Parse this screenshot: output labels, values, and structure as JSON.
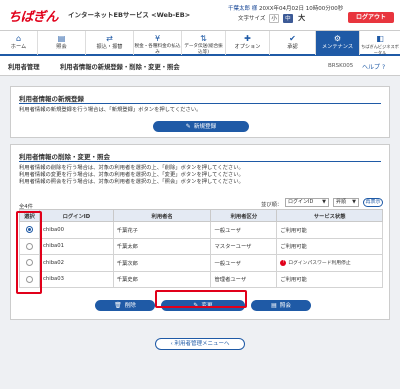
{
  "header": {
    "logo_text": "ちばぎん",
    "service_name": "インターネットEBサービス <Web-EB>",
    "user_name": "千葉太郎 様",
    "last_login": "20XX年04月02日 10時00分00秒",
    "font_size_label": "文字サイズ",
    "font_sizes": [
      "小",
      "中",
      "大"
    ],
    "logout_label": "ログアウト"
  },
  "nav": {
    "items": [
      {
        "label": "ホーム",
        "icon": "home-icon"
      },
      {
        "label": "照会",
        "icon": "inquiry-icon"
      },
      {
        "label": "振込・振替",
        "icon": "transfer-icon"
      },
      {
        "label": "税金・各種料金の払込み",
        "icon": "tax-icon"
      },
      {
        "label": "データ伝送(総合振込等)",
        "icon": "data-transfer-icon"
      },
      {
        "label": "オプション",
        "icon": "option-icon"
      },
      {
        "label": "承認",
        "icon": "approval-icon"
      },
      {
        "label": "メンテナンス",
        "icon": "maintenance-icon"
      },
      {
        "label": "ちばぎんビジネスポータル",
        "icon": "portal-icon"
      }
    ],
    "active_index": 7
  },
  "titlebar": {
    "section": "利用者管理",
    "page_title": "利用者情報の新規登録・削除・変更・照会",
    "screen_code": "BRSK005",
    "help_label": "ヘルプ"
  },
  "new_panel": {
    "heading": "利用者情報の新規登録",
    "description": "利用者情報の新規登録を行う場合は、「新規登録」ボタンを押してください。",
    "button_label": "新規登録"
  },
  "manage_panel": {
    "heading": "利用者情報の削除・変更・照会",
    "descriptions": [
      "利用者情報の削除を行う場合は、対象の利用者を選択の上、「削除」ボタンを押してください。",
      "利用者情報の変更を行う場合は、対象の利用者を選択の上、「変更」ボタンを押してください。",
      "利用者情報の照会を行う場合は、対象の利用者を選択の上、「照会」ボタンを押してください。"
    ],
    "count": "全4件",
    "sort_label": "並び順：",
    "sort_key": "ログインID",
    "sort_order": "昇順",
    "redisplay_label": "再表示",
    "columns": [
      "選択",
      "ログインID",
      "利用者名",
      "利用者区分",
      "サービス状態"
    ],
    "rows": [
      {
        "login_id": "chiba00",
        "name": "千葉花子",
        "category": "一般ユーザ",
        "status": "ご利用可能",
        "selected": true,
        "warning": false
      },
      {
        "login_id": "chiba01",
        "name": "千葉太郎",
        "category": "マスターユーザ",
        "status": "ご利用可能",
        "selected": false,
        "warning": false
      },
      {
        "login_id": "chiba02",
        "name": "千葉次郎",
        "category": "一般ユーザ",
        "status": "ログインパスワード利用停止",
        "selected": false,
        "warning": true
      },
      {
        "login_id": "chiba03",
        "name": "千葉史郎",
        "category": "管理者ユーザ",
        "status": "ご利用可能",
        "selected": false,
        "warning": false
      }
    ],
    "delete_label": "削除",
    "edit_label": "変更",
    "view_label": "照会"
  },
  "back_label": "利用者管理メニューへ",
  "colors": {
    "brand_red": "#e1001a",
    "nav_blue": "#1f5aa6",
    "highlight_red": "#e1001a"
  }
}
